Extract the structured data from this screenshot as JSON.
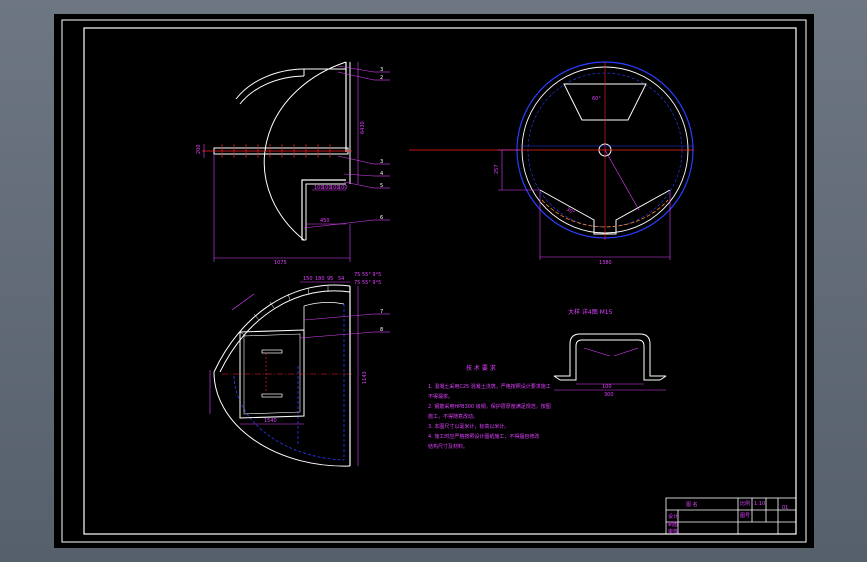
{
  "views": {
    "top_left": {
      "dims": {
        "thickness": "200",
        "height": "6430",
        "width": "1075",
        "opening": "450"
      },
      "callouts": [
        "3",
        "2",
        "3",
        "4",
        "5",
        "6"
      ],
      "bottom_dims": [
        "100",
        "100",
        "100",
        "100"
      ]
    },
    "top_right": {
      "dims": {
        "angle": "60°",
        "width": "1380",
        "side": "257",
        "chord": "30°"
      }
    },
    "bottom_left": {
      "dims": {
        "top_a": "150",
        "top_b": "180",
        "top_c": "95",
        "top_d": "54",
        "note_a": "75 55° 9°5",
        "note_b": "75 55° 9°5",
        "inner": "1540",
        "height": "1143"
      },
      "callouts": [
        "7",
        "8"
      ]
    },
    "detail": {
      "title": "大样 详4图  M15",
      "dims": {
        "inner": "100",
        "outer": "300"
      }
    }
  },
  "notes": {
    "title": "技 术 要 求",
    "lines": [
      "1. 混凝土采用C25 混凝土浇筑，严格按照设计要求施工",
      "   不得漏浆。",
      "2. 钢筋采用HPB300 级钢，保护层厚度满足规范，按图",
      "   施工，不得随意改动。",
      "3. 本图尺寸以毫米计，标高以米计。",
      "4. 施工时应严格按照设计图纸施工，不得擅自修改",
      "   结构尺寸及材料。"
    ]
  },
  "title_block": {
    "drawing_name": "图 名",
    "scale_label": "比例",
    "scale_value": "1:10",
    "sheet_label": "图号",
    "sheet_value": "01",
    "row_labels": [
      "设计",
      "制图",
      "审核"
    ]
  },
  "colors": {
    "white": "#ffffff",
    "magenta": "#e040ff",
    "red": "#ff2020",
    "blue": "#2a3cff",
    "orange": "#ff8a20",
    "gray": "#8a8a8a"
  }
}
